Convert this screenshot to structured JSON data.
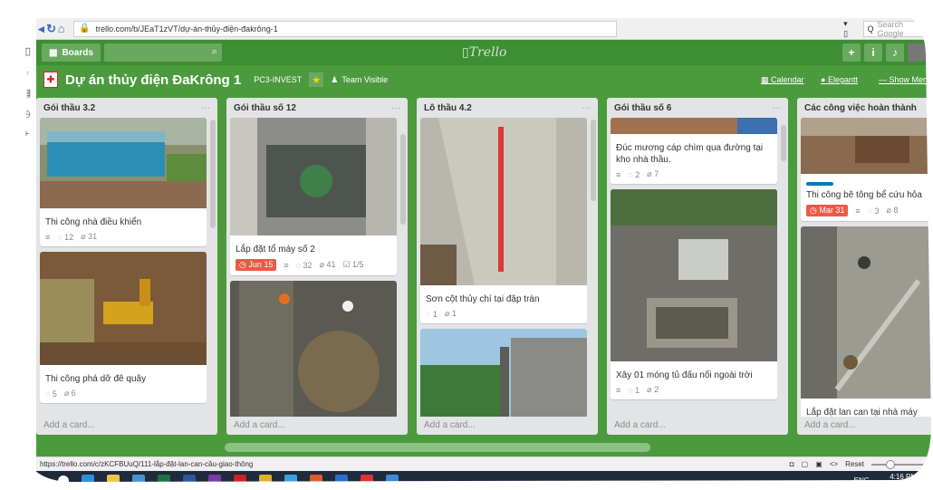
{
  "browser": {
    "url": "trello.com/b/JEaT1zVT/dự-án-thủy-điện-đakrông-1",
    "search_placeholder": "Search Google"
  },
  "header": {
    "boards_label": "Boards",
    "logo_text": "Trello",
    "add_label": "+",
    "info_label": "i"
  },
  "board": {
    "title": "Dự án thủy điện ĐaKrông 1",
    "org": "PC3-INVEST",
    "visibility": "Team Visible",
    "calendar": "Calendar",
    "elegantt": "Elegantt",
    "show_menu": "Show Menu"
  },
  "lists": [
    {
      "name": "Gói thầu 3.2",
      "cards": [
        {
          "title": "Thi công nhà điều khiển",
          "comments": "12",
          "attachments": "31"
        },
        {
          "title": "Thi công phá dỡ đê quây",
          "comments": "5",
          "attachments": "6"
        }
      ],
      "add_card": "Add a card..."
    },
    {
      "name": "Gói thầu số 12",
      "cards": [
        {
          "title": "Lắp đặt tổ máy số 2",
          "due": "Jun 15",
          "comments": "32",
          "attachments": "41",
          "checklist": "1/5"
        }
      ],
      "add_card": "Add a card..."
    },
    {
      "name": "Lô thầu 4.2",
      "cards": [
        {
          "title": "Sơn cột thủy chí tại đập tràn",
          "comments": "1",
          "attachments": "1"
        }
      ],
      "add_card": "Add a card..."
    },
    {
      "name": "Gói thầu số 6",
      "cards": [
        {
          "title": "Đúc mương cáp chìm qua đường tại kho nhà thầu.",
          "comments": "2",
          "attachments": "7"
        },
        {
          "title": "Xây 01 móng tủ đấu nối ngoài trời",
          "comments": "1",
          "attachments": "2"
        }
      ],
      "add_card": "Add a card..."
    },
    {
      "name": "Các công việc hoàn thành",
      "cards": [
        {
          "title": "Thi công bê tông bể cứu hỏa",
          "due": "Mar 31",
          "comments": "3",
          "attachments": "8"
        },
        {
          "title": "Lắp đặt lan can tại nhà máy"
        }
      ],
      "add_card": "Add a card..."
    }
  ],
  "status": {
    "url": "https://trello.com/c/zKCFBUuQ/111-lắp-đặt-lan-can-cầu-giao-thông",
    "reset": "Reset"
  },
  "taskbar": {
    "lang": "ENG",
    "time": "4:16 PM"
  },
  "colors": {
    "trello_green": "#4c9a3e",
    "due_red": "#eb5a46"
  }
}
